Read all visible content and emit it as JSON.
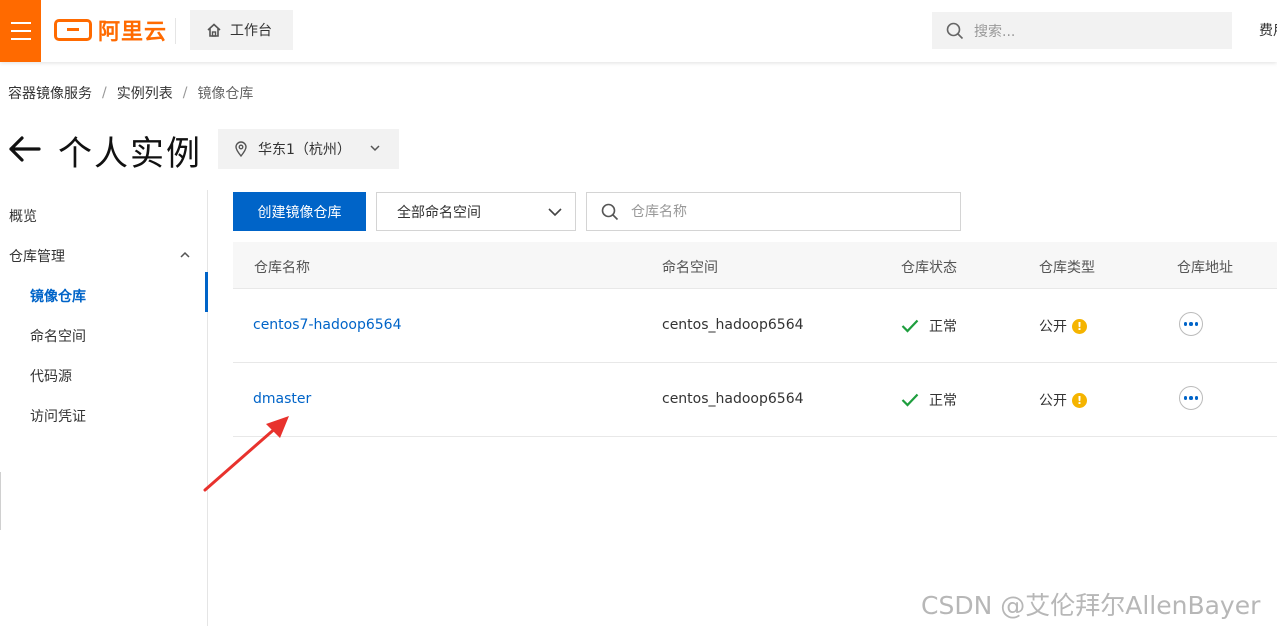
{
  "topbar": {
    "logo_text": "阿里云",
    "workbench_label": "工作台",
    "search_placeholder": "搜索...",
    "fee_label": "费用"
  },
  "breadcrumb": [
    "容器镜像服务",
    "实例列表",
    "镜像仓库"
  ],
  "page": {
    "title": "个人实例",
    "region": "华东1（杭州）"
  },
  "sidebar": {
    "overview": "概览",
    "repo_manage": "仓库管理",
    "items": [
      "镜像仓库",
      "命名空间",
      "代码源",
      "访问凭证"
    ]
  },
  "toolbar": {
    "create_label": "创建镜像仓库",
    "namespace_select": "全部命名空间",
    "search_placeholder": "仓库名称"
  },
  "table": {
    "headers": [
      "仓库名称",
      "命名空间",
      "仓库状态",
      "仓库类型",
      "仓库地址"
    ],
    "rows": [
      {
        "name": "centos7-hadoop6564",
        "namespace": "centos_hadoop6564",
        "status": "正常",
        "type": "公开"
      },
      {
        "name": "dmaster",
        "namespace": "centos_hadoop6564",
        "status": "正常",
        "type": "公开"
      }
    ]
  },
  "watermark": "CSDN @艾伦拜尔AllenBayer",
  "colors": {
    "accent": "#0064c8",
    "brand": "#ff6a00",
    "ok": "#1e9e3e",
    "warn": "#f5b400",
    "annotation": "#e8322d"
  }
}
